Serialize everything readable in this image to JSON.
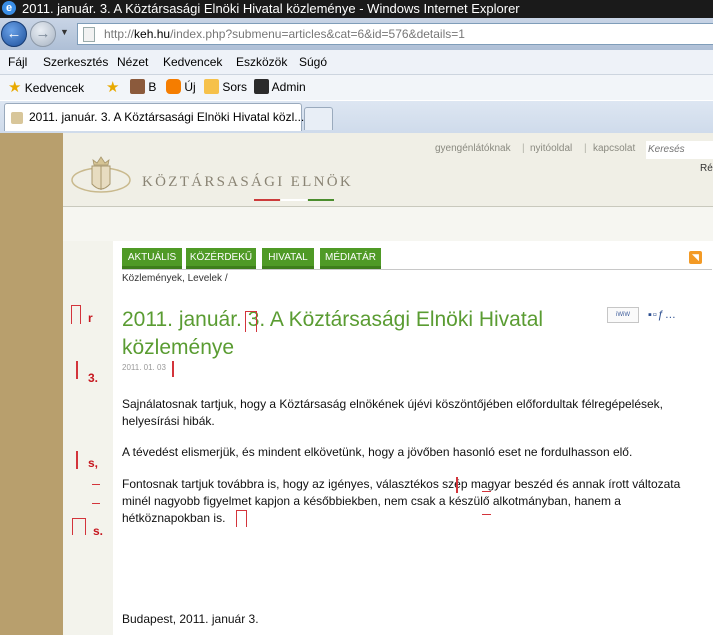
{
  "window": {
    "title": "2011. január. 3. A Köztársasági Elnöki Hivatal közleménye - Windows Internet Explorer"
  },
  "address": {
    "prefix": "http://",
    "host": "keh.hu",
    "path": "/index.php?submenu=articles&cat=6&id=576&details=1"
  },
  "menu": [
    "Fájl",
    "Szerkesztés",
    "Nézet",
    "Kedvencek",
    "Eszközök",
    "Súgó"
  ],
  "favorites": {
    "label": "Kedvencek",
    "items": [
      "B",
      "Új",
      "Sors",
      "Admin"
    ]
  },
  "tab": {
    "label": "2011. január. 3. A Köztársasági Elnöki Hivatal közl..."
  },
  "site": {
    "top_links": [
      "gyengénlátóknak",
      "nyitóoldal",
      "kapcsolat"
    ],
    "search_placeholder": "Keresés",
    "re_text": "Ré",
    "title": "KÖZTÁRSASÁGI ELNÖK",
    "nav": [
      "AKTUÁLIS",
      "KÖZÉRDEKŰ",
      "HIVATAL",
      "MÉDIATÁR"
    ]
  },
  "article": {
    "breadcrumb": "Közlemények, Levelek /",
    "title": "2011. január. 3. A Köztársasági Elnöki Hivatal közleménye",
    "date": "2011. 01. 03",
    "p1": "Sajnálatosnak tartjuk, hogy a Köztársaság elnökének újévi köszöntőjében előfordultak félregépelések, helyesírási hibák.",
    "p2": "A tévedést elismerjük, és mindent elkövetünk, hogy a jövőben hasonló eset ne fordulhasson elő.",
    "p3": "Fontosnak tartjuk továbbra is, hogy az igényes, választékos szép magyar beszéd és annak írott változata minél nagyobb figyelmet kapjon a későbbiekben, nem csak a készülő alkotmányban, hanem a hétköznapokban is.",
    "closing": "Budapest, 2011. január 3.",
    "share_label": "iWiW"
  },
  "margin_marks": [
    "r",
    "3.",
    "s,",
    "s."
  ],
  "colors": {
    "green": "#5a9c32",
    "nav_green": "#4f9a26",
    "proof_red": "#c6171f"
  }
}
